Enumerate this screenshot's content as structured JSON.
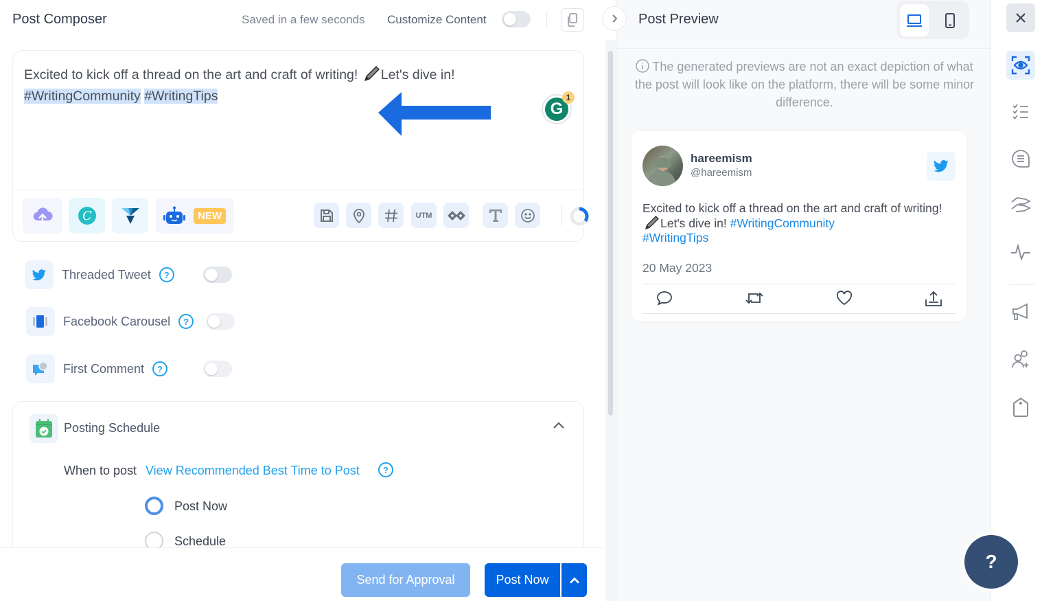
{
  "composer": {
    "title": "Post Composer",
    "saved_status": "Saved in a few seconds",
    "customize_label": "Customize Content",
    "customize_enabled": false,
    "editor": {
      "text_main": "Excited to kick off a thread on the art and craft of writing! ",
      "text_after_emoji": "Let's dive in!",
      "hashtag_1": "#WritingCommunity",
      "hashtag_2": "#WritingTips",
      "grammarly_badge": "1",
      "grammarly_letter": "G"
    },
    "toolbar": {
      "left_tools": [
        "upload-media",
        "canva",
        "vistacreate",
        "ai-assistant"
      ],
      "new_badge": "NEW",
      "utm_label": "UTM",
      "right_tools": [
        "save-draft",
        "location",
        "hashtag",
        "utm",
        "link-shortener",
        "text-format",
        "emoji"
      ],
      "character_progress": 0.35
    },
    "options": [
      {
        "label": "Threaded Tweet",
        "enabled": false
      },
      {
        "label": "Facebook Carousel",
        "enabled": false
      },
      {
        "label": "First Comment",
        "enabled": false
      }
    ],
    "schedule": {
      "title": "Posting Schedule",
      "when_label": "When to post",
      "best_time_link": "View Recommended Best Time to Post",
      "radio_options": [
        {
          "label": "Post Now",
          "checked": true
        },
        {
          "label": "Schedule",
          "checked": false
        }
      ]
    },
    "footer": {
      "approval_label": "Send for Approval",
      "post_now_label": "Post Now"
    }
  },
  "preview": {
    "title": "Post Preview",
    "active_device": "desktop",
    "note": "The generated previews are not an exact depiction of what the post will look like on the platform, there will be some minor difference.",
    "tweet": {
      "name": "hareemism",
      "handle": "@hareemism",
      "text_1": "Excited to kick off a thread on the art and craft of writing! ",
      "text_2": "Let's dive in! ",
      "hashtag_1": "#WritingCommunity",
      "hashtag_2": "#WritingTips",
      "date": "20 May 2023"
    }
  },
  "rail": {
    "items": [
      "close",
      "preview",
      "checklist",
      "comments",
      "handshake",
      "activity",
      "campaign",
      "add-user",
      "tag"
    ],
    "active": "preview"
  },
  "help_fab": "?",
  "colors": {
    "primary": "#0064e1",
    "link": "#1fa3ee",
    "hashtag_highlight": "#cfe3fb",
    "twitter": "#1d9bf0",
    "new_badge": "#ffc65a",
    "help_fab": "#344f73"
  }
}
